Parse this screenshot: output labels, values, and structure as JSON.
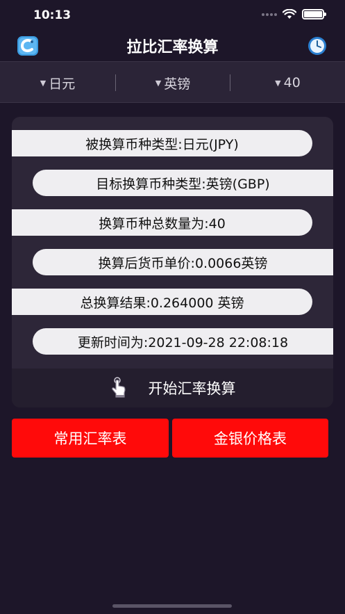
{
  "status": {
    "time": "10:13"
  },
  "nav": {
    "title": "拉比汇率换算",
    "left_icon": "app-logo-icon",
    "right_icon": "clock-icon"
  },
  "selectors": {
    "from_currency": "日元",
    "to_currency": "英镑",
    "amount": "40"
  },
  "result": {
    "source_type": "被换算币种类型:日元(JPY)",
    "target_type": "目标换算币种类型:英镑(GBP)",
    "amount": "换算币种总数量为:40",
    "unit_price": "换算后货币单价:0.0066英镑",
    "total": "总换算结果:0.264000 英镑",
    "updated": "更新时间为:2021-09-28 22:08:18"
  },
  "actions": {
    "start_label": "开始汇率换算",
    "common_rates_label": "常用汇率表",
    "gold_silver_label": "金银价格表"
  },
  "colors": {
    "background": "#1d1629",
    "accent_button": "#ff0a0a",
    "pill_bg": "#efeef1",
    "card_bg": "#2d2638"
  }
}
